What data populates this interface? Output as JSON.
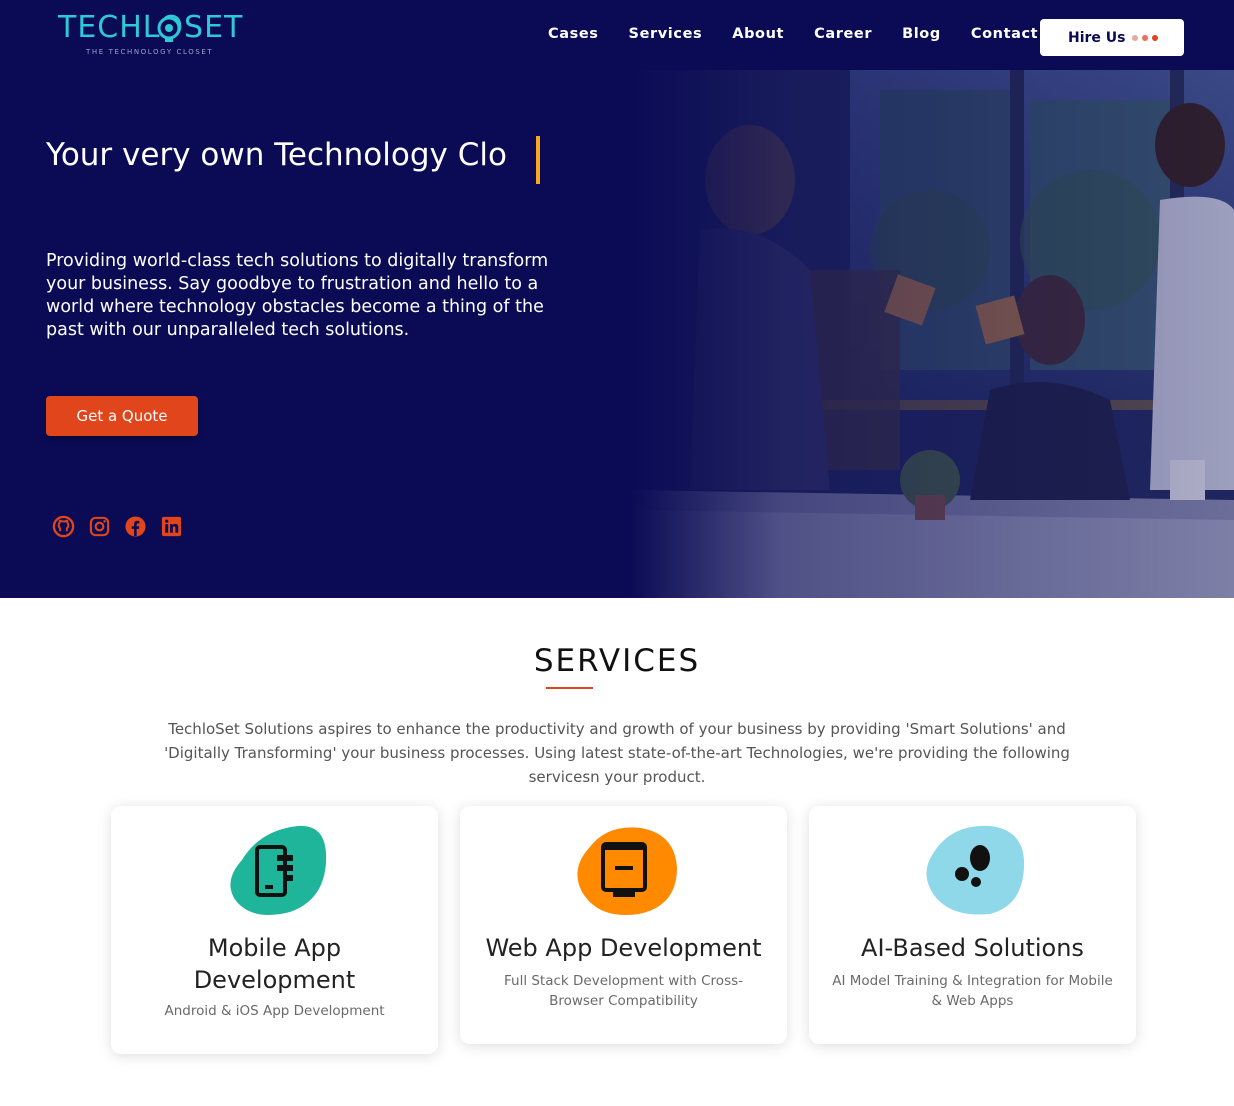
{
  "brand": {
    "name": "TECHLOSET",
    "tagline": "THE TECHNOLOGY CLOSET",
    "primary_color": "#0b0b55",
    "accent_color": "#e1451b",
    "logo_color": "#2ec9d9"
  },
  "nav": {
    "links": [
      "Cases",
      "Services",
      "About",
      "Career",
      "Blog",
      "Contact"
    ],
    "hire_label": "Hire Us",
    "hire_dots": [
      "#e8a89a",
      "#e4725c",
      "#e1451b"
    ]
  },
  "hero": {
    "title": "Your very own Technology Clo",
    "description": "Providing world-class tech solutions to digitally transform your business. Say goodbye to frustration and hello to a world where technology obstacles become a thing of the past with our unparalleled tech solutions.",
    "cta_label": "Get a Quote",
    "socials": [
      "github-icon",
      "instagram-icon",
      "facebook-icon",
      "linkedin-icon"
    ]
  },
  "services": {
    "heading": "SERVICES",
    "intro": "TechloSet Solutions aspires to enhance the productivity and growth of your business by providing 'Smart Solutions' and 'Digitally Transforming' your business processes. Using latest state-of-the-art Technologies, we're providing the following servicesn your product.",
    "cards": [
      {
        "title": "Mobile App Development",
        "subtitle": "Android & iOS App Development",
        "icon": "mobile-app-icon",
        "blob_color": "#1fb59a"
      },
      {
        "title": "Web App Development",
        "subtitle": "Full Stack Development with Cross-Browser Compatibility",
        "icon": "web-app-icon",
        "blob_color": "#ff8a00"
      },
      {
        "title": "AI-Based Solutions",
        "subtitle": "AI Model Training & Integration for Mobile & Web Apps",
        "icon": "ai-icon",
        "blob_color": "#8fd8ea"
      }
    ]
  }
}
